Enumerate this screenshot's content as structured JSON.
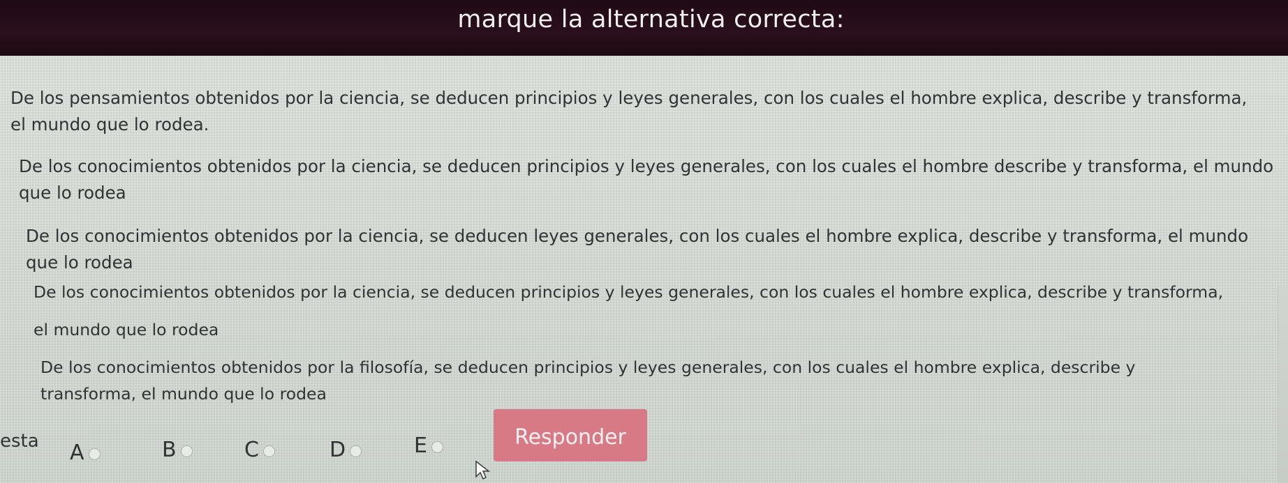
{
  "header": {
    "title": "marque la alternativa correcta:"
  },
  "options": [
    {
      "letter": "A",
      "text": "De los pensamientos obtenidos por la ciencia, se deducen principios y leyes generales, con los cuales el hombre explica, describe y transforma, el mundo que lo rodea."
    },
    {
      "letter": "B",
      "text": "De los conocimientos obtenidos por la ciencia, se deducen principios y leyes generales, con los cuales el hombre describe y transforma, el mundo que lo rodea"
    },
    {
      "letter": "C",
      "text": "De los conocimientos obtenidos por la ciencia, se deducen leyes generales, con los cuales el hombre explica, describe y transforma, el mundo que lo rodea"
    },
    {
      "letter": "D",
      "text": "De los conocimientos obtenidos por la ciencia, se deducen principios y leyes generales, con los cuales el hombre explica, describe y transforma, el mundo que lo rodea"
    },
    {
      "letter": "E",
      "text": "De los conocimientos obtenidos por la filosofía, se deducen principios y leyes generales, con los cuales el hombre explica, describe y transforma, el mundo que lo rodea"
    }
  ],
  "answer": {
    "label": "esta",
    "choices": [
      "A",
      "B",
      "C",
      "D",
      "E"
    ],
    "button_label": "Responder"
  },
  "colors": {
    "header_bg": "#200a16",
    "button_bg": "#d87a85",
    "page_bg": "#d6dcd6"
  },
  "icons": {
    "cursor": "arrow-cursor-icon",
    "radio": "radio-empty-icon"
  }
}
